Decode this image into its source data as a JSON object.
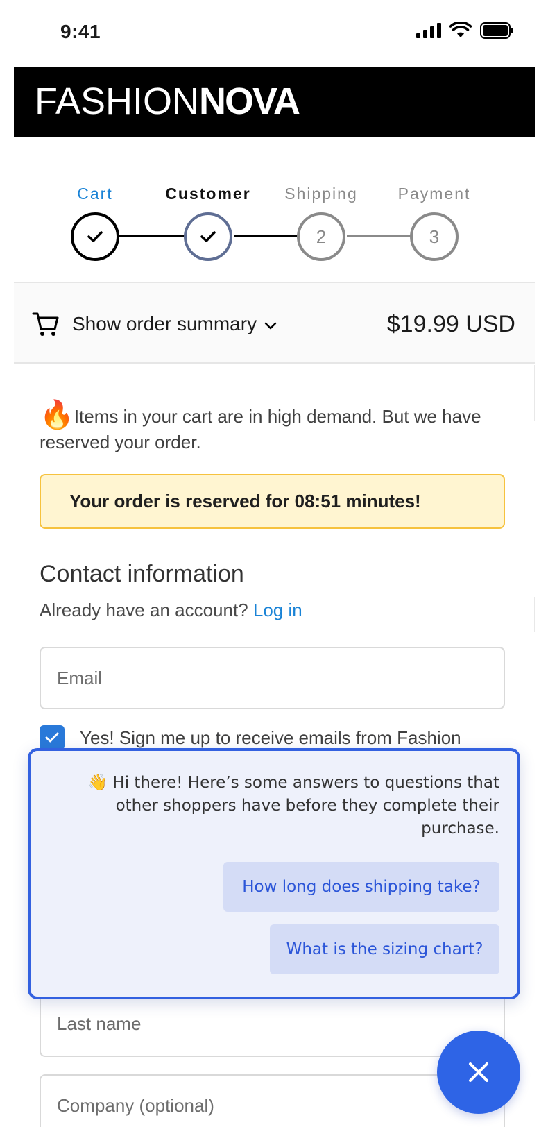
{
  "status_bar": {
    "time": "9:41"
  },
  "brand": {
    "logo_light": "FASHION",
    "logo_bold": "NOVA"
  },
  "stepper": {
    "steps": [
      {
        "label": "Cart",
        "state": "done",
        "marker": "check"
      },
      {
        "label": "Customer",
        "state": "current",
        "marker": "check"
      },
      {
        "label": "Shipping",
        "state": "upcoming",
        "marker": "2"
      },
      {
        "label": "Payment",
        "state": "upcoming",
        "marker": "3"
      }
    ]
  },
  "order_summary": {
    "toggle_label": "Show order summary",
    "total": "$19.99 USD"
  },
  "demand_notice": {
    "message": "Items in your cart are in high demand. But we have reserved your order.",
    "reservation": "Your order is reserved for 08:51 minutes!"
  },
  "contact": {
    "title": "Contact information",
    "account_prompt": "Already have an account?",
    "login_label": "Log in",
    "email_placeholder": "Email",
    "newsletter_label": "Yes! Sign me up to receive emails from Fashion",
    "newsletter_checked": true
  },
  "form": {
    "last_name_placeholder": "Last name",
    "company_placeholder": "Company (optional)"
  },
  "chat": {
    "greeting_emoji": "👋",
    "greeting": "Hi there! Here’s some answers to questions that other shoppers have before they complete their purchase.",
    "suggestions": [
      "How long does shipping take?",
      "What is the sizing chart?"
    ]
  },
  "colors": {
    "accent_blue": "#3361e0",
    "link_blue": "#1a83d6",
    "step_active_blue": "#1a83d6",
    "reserve_bg": "#fff5d1",
    "reserve_border": "#f6c23e",
    "chat_bg": "#eef1fb"
  }
}
